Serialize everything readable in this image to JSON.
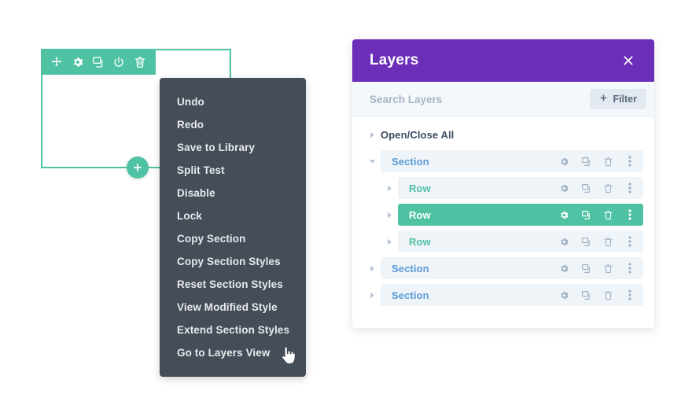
{
  "builder": {
    "section_toolbar": {
      "icons": [
        {
          "name": "move-icon",
          "label": "Move Section"
        },
        {
          "name": "gear-icon",
          "label": "Section Settings"
        },
        {
          "name": "duplicate-icon",
          "label": "Duplicate Section"
        },
        {
          "name": "power-icon",
          "label": "Disable Section"
        },
        {
          "name": "trash-icon",
          "label": "Delete Section"
        }
      ]
    },
    "add_button_label": "+",
    "accent_green": "#4fc2a4"
  },
  "context_menu": {
    "background": "#444d58",
    "items": [
      {
        "label": "Undo"
      },
      {
        "label": "Redo"
      },
      {
        "label": "Save to Library"
      },
      {
        "label": "Split Test"
      },
      {
        "label": "Disable"
      },
      {
        "label": "Lock"
      },
      {
        "label": "Copy Section"
      },
      {
        "label": "Copy Section Styles"
      },
      {
        "label": "Reset Section Styles"
      },
      {
        "label": "View Modified Style"
      },
      {
        "label": "Extend Section Styles"
      },
      {
        "label": "Go to Layers View"
      }
    ]
  },
  "layers_panel": {
    "title": "Layers",
    "header_color": "#6c2eb9",
    "close_icon": "close-icon",
    "search": {
      "placeholder": "Search Layers",
      "value": ""
    },
    "filter_button": {
      "label": "Filter",
      "icon": "plus-icon"
    },
    "tree": [
      {
        "label": "Open/Close All",
        "type": "header",
        "indent": 0,
        "expanded": false,
        "selected": false,
        "actions": []
      },
      {
        "label": "Section",
        "type": "section",
        "indent": 0,
        "expanded": true,
        "selected": false,
        "actions": [
          "gear-icon",
          "duplicate-icon",
          "trash-icon",
          "more-icon"
        ]
      },
      {
        "label": "Row",
        "type": "row",
        "indent": 1,
        "expanded": false,
        "selected": false,
        "actions": [
          "gear-icon",
          "duplicate-icon",
          "trash-icon",
          "more-icon"
        ]
      },
      {
        "label": "Row",
        "type": "row",
        "indent": 1,
        "expanded": false,
        "selected": true,
        "actions": [
          "gear-icon",
          "duplicate-icon",
          "trash-icon",
          "more-icon"
        ]
      },
      {
        "label": "Row",
        "type": "row",
        "indent": 1,
        "expanded": false,
        "selected": false,
        "actions": [
          "gear-icon",
          "duplicate-icon",
          "trash-icon",
          "more-icon"
        ]
      },
      {
        "label": "Section",
        "type": "section",
        "indent": 0,
        "expanded": false,
        "selected": false,
        "actions": [
          "gear-icon",
          "duplicate-icon",
          "trash-icon",
          "more-icon"
        ]
      },
      {
        "label": "Section",
        "type": "section",
        "indent": 0,
        "expanded": false,
        "selected": false,
        "actions": [
          "gear-icon",
          "duplicate-icon",
          "trash-icon",
          "more-icon"
        ]
      }
    ],
    "colors": {
      "section_label": "#5b9bd5",
      "row_label": "#4fc2a4",
      "selected_row_bg": "#4fc2a4",
      "row_bg": "#eff4f9"
    }
  }
}
